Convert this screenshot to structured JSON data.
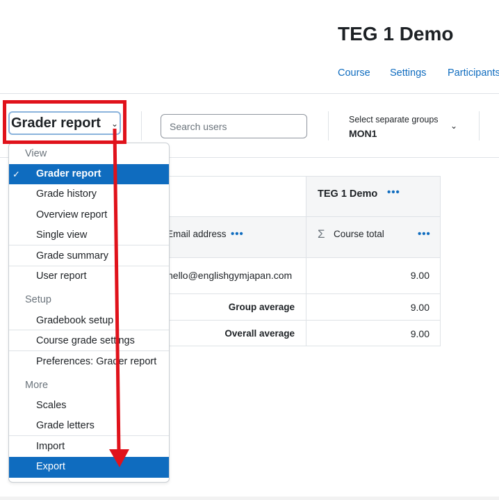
{
  "header": {
    "course_title": "TEG 1 Demo",
    "nav": [
      "Course",
      "Settings",
      "Participants"
    ]
  },
  "toolbar": {
    "report_select_label": "Grader report",
    "search_placeholder": "Search users",
    "groups_label": "Select separate groups",
    "groups_value": "MON1"
  },
  "dropdown": {
    "sections": [
      {
        "header": "View",
        "items": [
          "Grader report",
          "Grade history",
          "Overview report",
          "Single view",
          "Grade summary",
          "User report"
        ]
      },
      {
        "header": "Setup",
        "items": [
          "Gradebook setup",
          "Course grade settings",
          "Preferences: Grader report"
        ]
      },
      {
        "header": "More",
        "items": [
          "Scales",
          "Grade letters",
          "Import",
          "Export"
        ]
      }
    ],
    "active_item": "Grader report",
    "highlighted_item": "Export"
  },
  "grid": {
    "category_header": "TEG 1 Demo",
    "email_header": "Email address",
    "course_total_header": "Course total",
    "rows": [
      {
        "email": "hello@englishgymjapan.com",
        "total": "9.00"
      }
    ],
    "group_average_label": "Group average",
    "group_average_value": "9.00",
    "overall_average_label": "Overall average",
    "overall_average_value": "9.00"
  },
  "colors": {
    "accent": "#0f6cbf",
    "annotation_red": "#e0121b",
    "text": "#1d2125"
  },
  "icons": [
    "check-icon",
    "chevron-down-icon",
    "sigma-icon",
    "more-options-icon"
  ]
}
